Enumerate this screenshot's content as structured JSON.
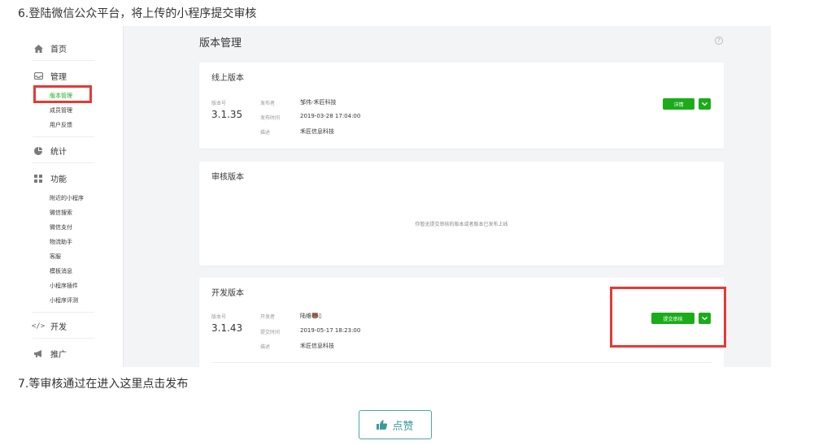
{
  "steps": {
    "step6": "6.登陆微信公众平台，将上传的小程序提交审核",
    "step7": "7.等审核通过在进入这里点击发布"
  },
  "sidebar": {
    "groups": [
      {
        "label": "首页",
        "icon": "home-icon"
      },
      {
        "label": "管理",
        "icon": "inbox-icon"
      },
      {
        "label": "统计",
        "icon": "pie-chart-icon"
      },
      {
        "label": "功能",
        "icon": "grid-icon"
      },
      {
        "label": "开发",
        "icon": "code-icon"
      },
      {
        "label": "推广",
        "icon": "megaphone-icon"
      }
    ],
    "manage_items": [
      "版本管理",
      "成员管理",
      "用户反馈"
    ],
    "feature_items": [
      "附近的小程序",
      "微信搜索",
      "微信支付",
      "物流助手",
      "客服",
      "模板消息",
      "小程序插件",
      "小程序评测"
    ]
  },
  "main": {
    "title": "版本管理",
    "online": {
      "title": "线上版本",
      "version_label": "版本号",
      "version": "3.1.35",
      "publisher_label": "发布者",
      "publisher": "邹伟-禾匠科技",
      "time_label": "发布时间",
      "time": "2019-03-28 17:04:00",
      "desc_label": "描述",
      "desc": "禾匠信息科技",
      "detail_button": "详情"
    },
    "review": {
      "title": "审核版本",
      "empty": "你暂无提交审核的版本或者版本已发布上线"
    },
    "dev": {
      "title": "开发版本",
      "version_label": "版本号",
      "version": "3.1.43",
      "developer_label": "开发者",
      "developer": "陆维🐻▯",
      "time_label": "提交时间",
      "time": "2019-05-17 18:23:00",
      "desc_label": "描述",
      "desc": "禾匠信息科技",
      "submit_button": "提交审核"
    }
  },
  "like_button": "点赞",
  "colors": {
    "accent_green": "#1aad19",
    "highlight_red": "#e53935",
    "like_teal": "#3b9a9a"
  }
}
